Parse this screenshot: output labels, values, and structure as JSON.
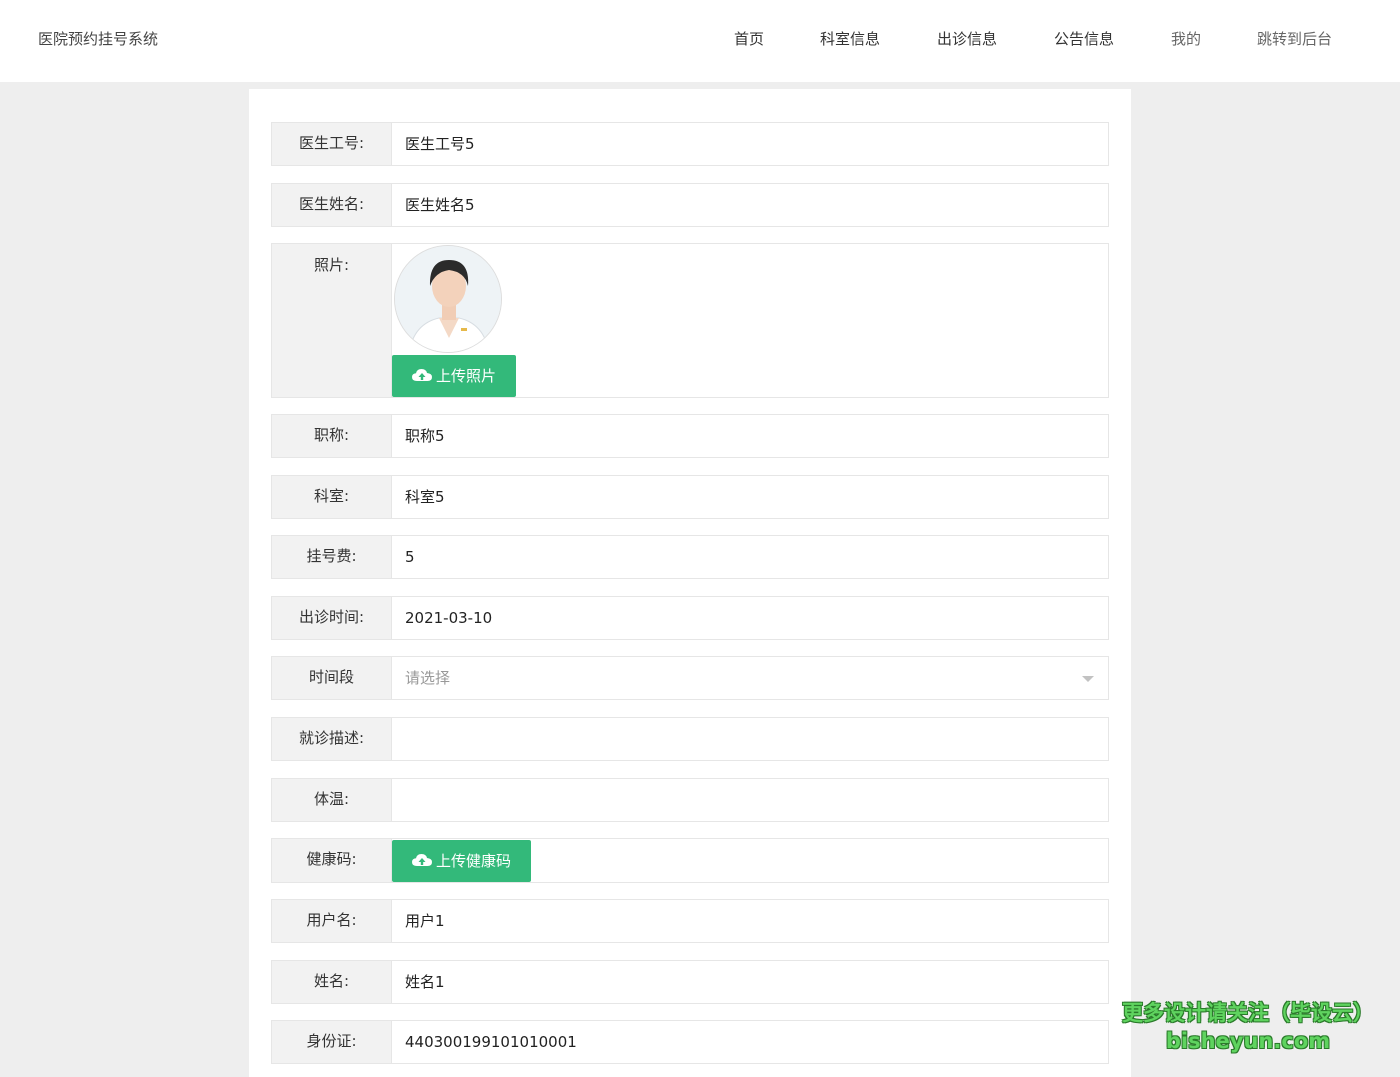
{
  "header": {
    "brand": "医院预约挂号系统",
    "nav": [
      "首页",
      "科室信息",
      "出诊信息",
      "公告信息",
      "我的",
      "跳转到后台"
    ]
  },
  "form": {
    "doctor_id": {
      "label": "医生工号:",
      "value": "医生工号5"
    },
    "doctor_name": {
      "label": "医生姓名:",
      "value": "医生姓名5"
    },
    "photo": {
      "label": "照片:",
      "upload_label": "上传照片"
    },
    "title": {
      "label": "职称:",
      "value": "职称5"
    },
    "department": {
      "label": "科室:",
      "value": "科室5"
    },
    "fee": {
      "label": "挂号费:",
      "value": "5"
    },
    "visit_date": {
      "label": "出诊时间:",
      "value": "2021-03-10"
    },
    "time_slot": {
      "label": "时间段",
      "placeholder": "请选择"
    },
    "description": {
      "label": "就诊描述:",
      "value": ""
    },
    "temperature": {
      "label": "体温:",
      "value": ""
    },
    "health_code": {
      "label": "健康码:",
      "upload_label": "上传健康码"
    },
    "username": {
      "label": "用户名:",
      "value": "用户1"
    },
    "name": {
      "label": "姓名:",
      "value": "姓名1"
    },
    "id_card": {
      "label": "身份证:",
      "value": "440300199101010001"
    }
  },
  "watermark": {
    "line1": "更多设计请关注（毕设云）",
    "line2": "bisheyun.com"
  },
  "colors": {
    "accent": "#33b97a",
    "background": "#eeeeee",
    "label_bg": "#f2f2f2"
  },
  "icons": {
    "upload": "cloud-upload-icon",
    "select": "chevron-down-icon"
  }
}
